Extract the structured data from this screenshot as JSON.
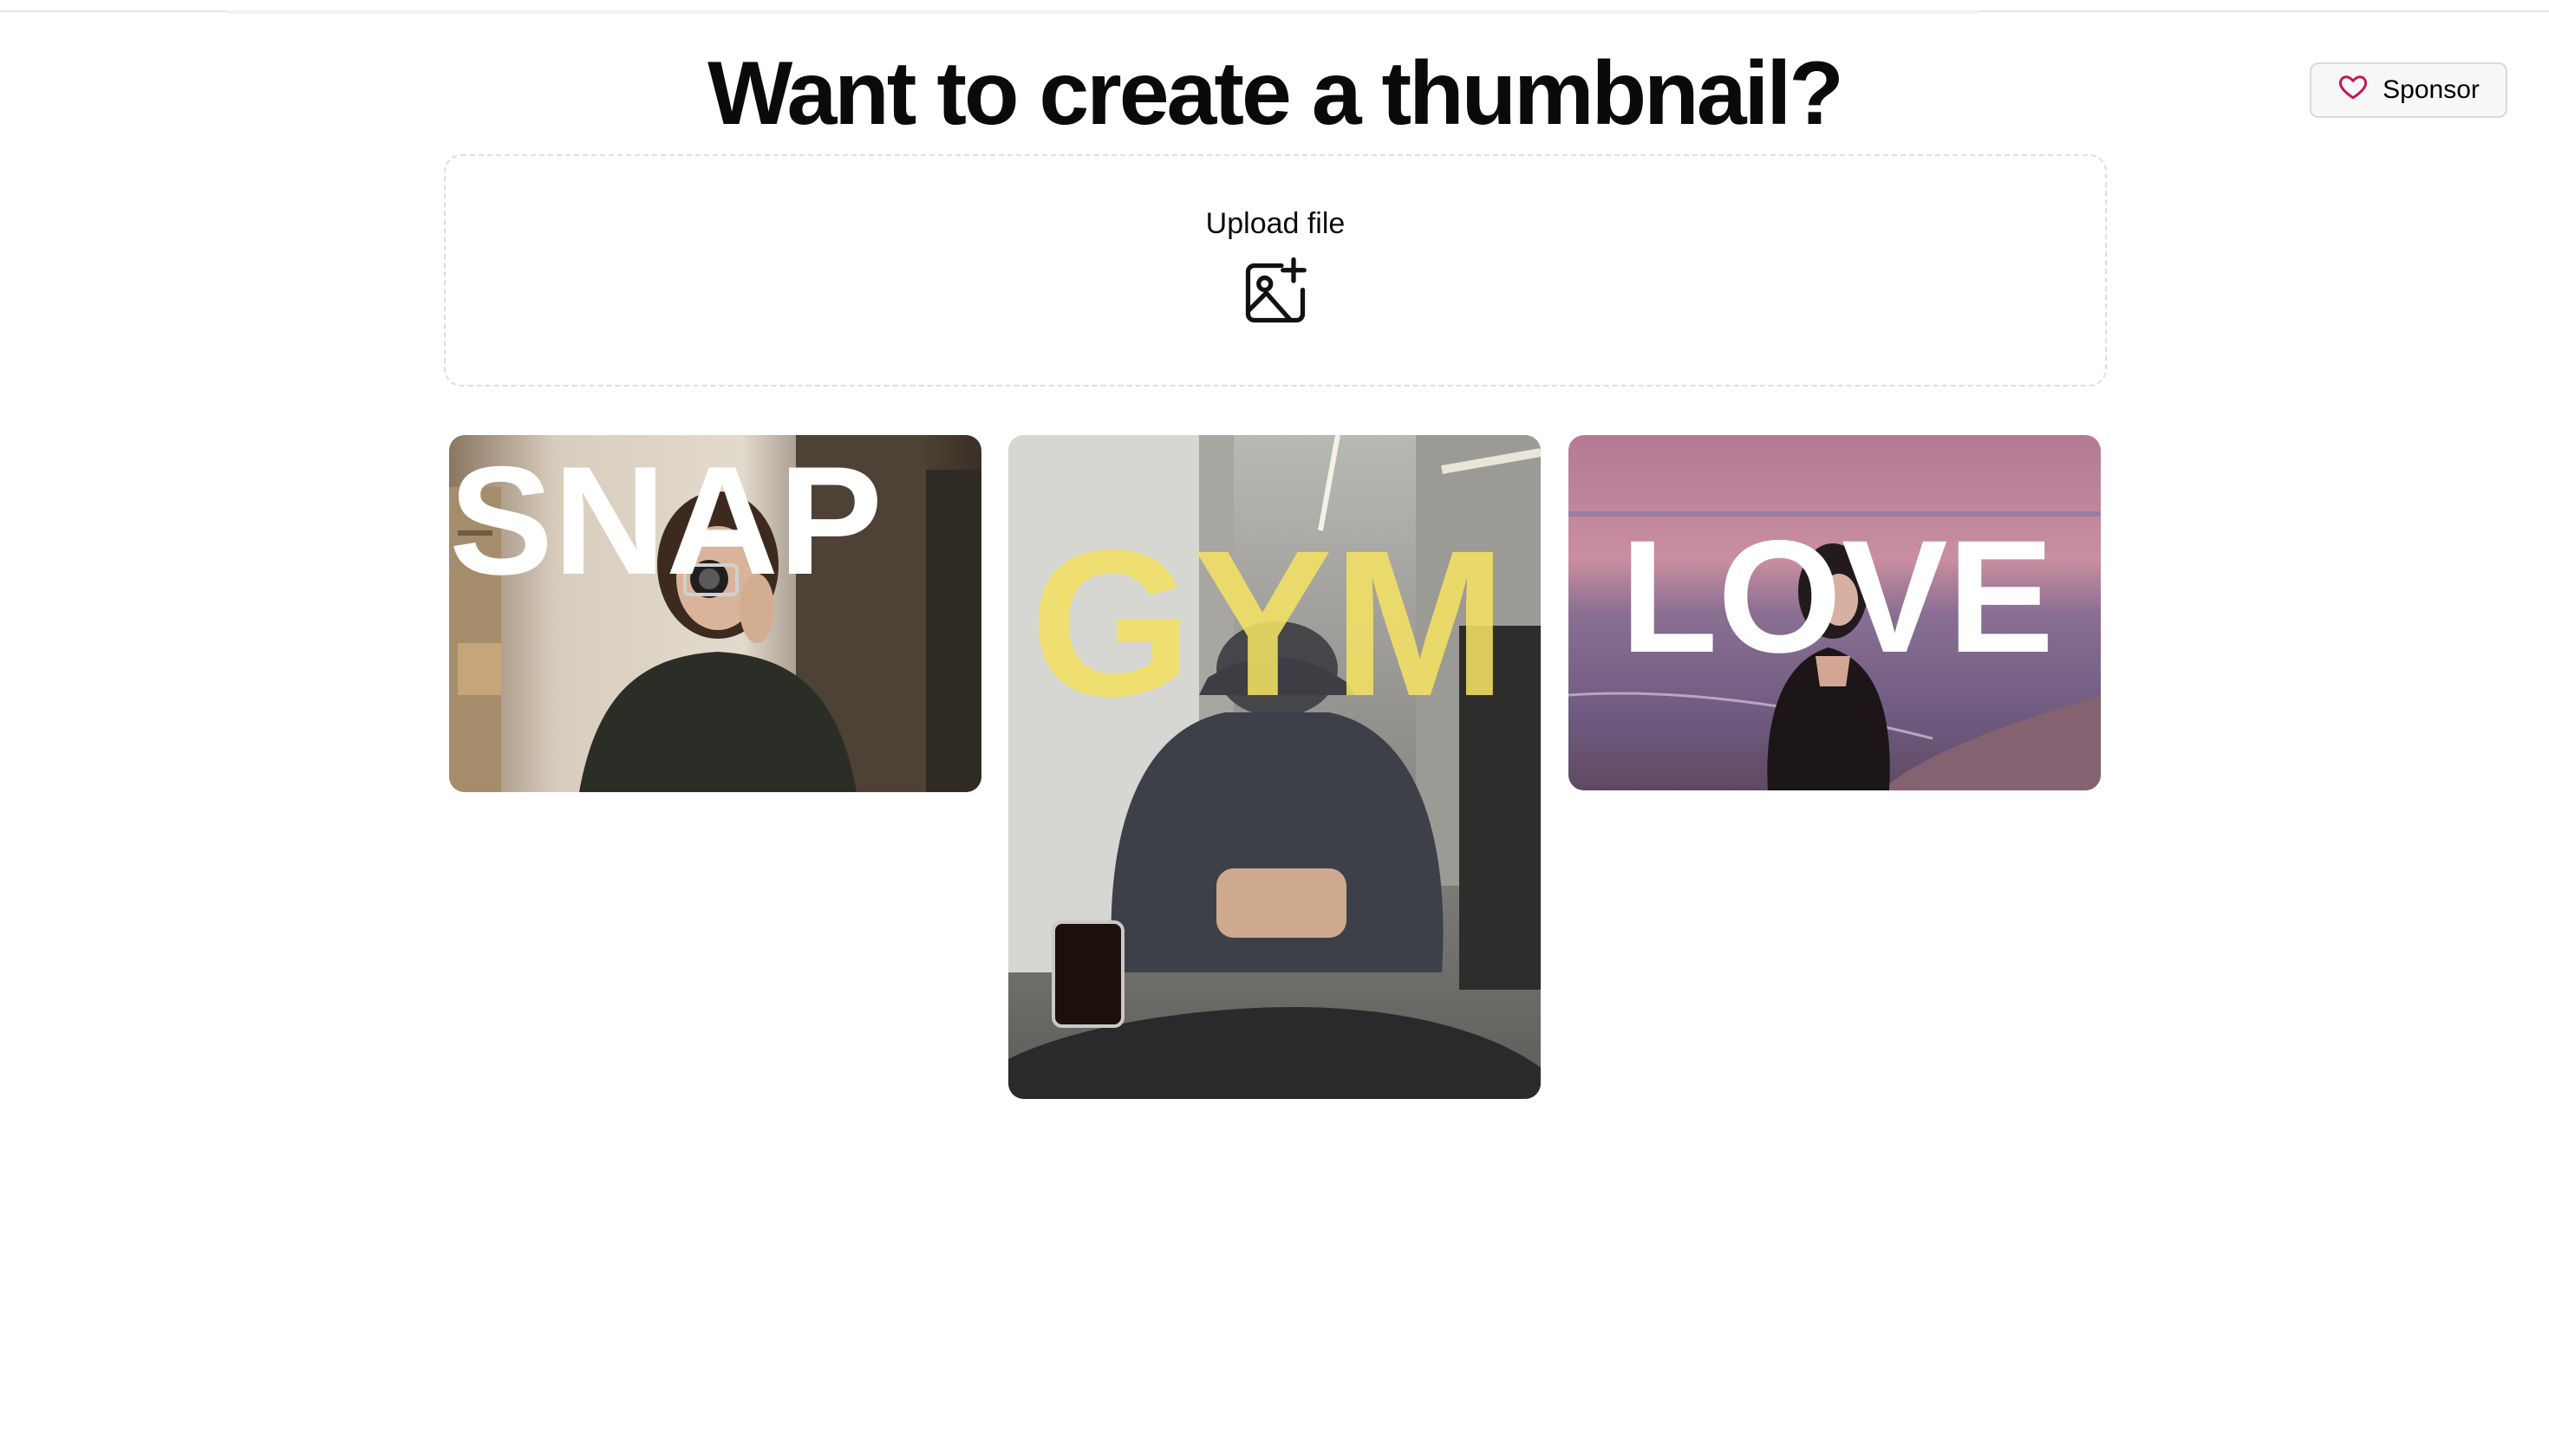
{
  "header": {
    "title": "Want to create a thumbnail?",
    "sponsor_label": "Sponsor",
    "sponsor_icon": "heart-icon",
    "sponsor_icon_color": "#c2185b"
  },
  "upload": {
    "label": "Upload file",
    "icon": "image-plus-icon"
  },
  "examples": [
    {
      "word": "SNAP",
      "word_color": "#ffffff"
    },
    {
      "word": "GYM",
      "word_color": "#f3e163"
    },
    {
      "word": "LOVE",
      "word_color": "#ffffff"
    }
  ]
}
